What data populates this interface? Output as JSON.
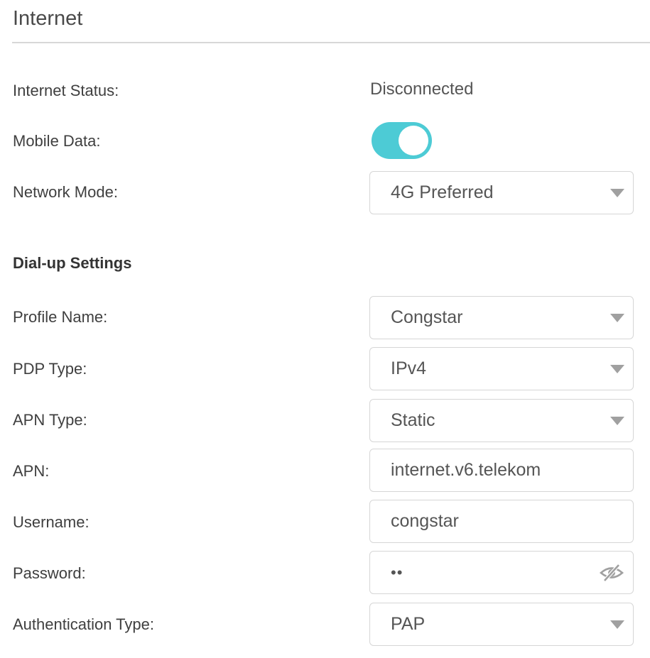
{
  "header": {
    "title": "Internet"
  },
  "status": {
    "label": "Internet Status:",
    "value": "Disconnected"
  },
  "mobile_data": {
    "label": "Mobile Data:",
    "enabled": true,
    "color": "#4dcbd5"
  },
  "network_mode": {
    "label": "Network Mode:",
    "value": "4G Preferred"
  },
  "dialup": {
    "section_title": "Dial-up Settings",
    "profile_name": {
      "label": "Profile Name:",
      "value": "Congstar"
    },
    "pdp_type": {
      "label": "PDP Type:",
      "value": "IPv4"
    },
    "apn_type": {
      "label": "APN Type:",
      "value": "Static"
    },
    "apn": {
      "label": "APN:",
      "value": "internet.v6.telekom"
    },
    "username": {
      "label": "Username:",
      "value": "congstar"
    },
    "password": {
      "label": "Password:",
      "value": "••",
      "visibility_icon": "eye-slash-icon"
    },
    "auth_type": {
      "label": "Authentication Type:",
      "value": "PAP"
    }
  }
}
